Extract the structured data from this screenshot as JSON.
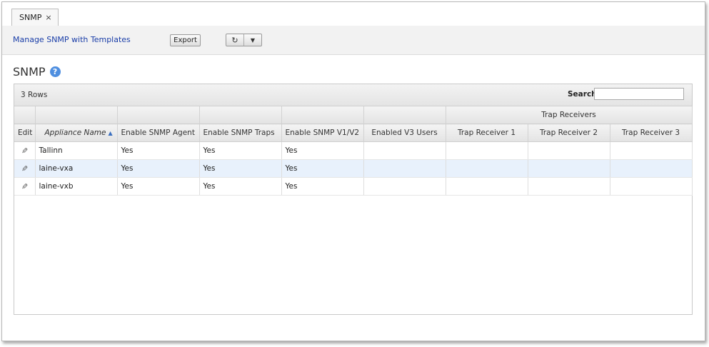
{
  "tab": {
    "label": "SNMP",
    "close": "×"
  },
  "toolbar": {
    "templates_link": "Manage SNMP with Templates",
    "export_label": "Export",
    "refresh_glyph": "↻",
    "menu_glyph": "▼"
  },
  "page": {
    "title": "SNMP",
    "help_glyph": "?"
  },
  "grid": {
    "rows_count": "3 Rows",
    "search_label": "Search",
    "search_value": "",
    "group_header": "Trap Receivers",
    "columns": {
      "edit": "Edit",
      "appliance": "Appliance Name",
      "agent": "Enable SNMP Agent",
      "traps": "Enable SNMP Traps",
      "v1v2": "Enable SNMP V1/V2",
      "v3users": "Enabled V3 Users",
      "tr1": "Trap Receiver 1",
      "tr2": "Trap Receiver 2",
      "tr3": "Trap Receiver 3"
    },
    "sort_glyph": "▲",
    "edit_glyph": "✎",
    "rows": [
      {
        "appliance": "Tallinn",
        "agent": "Yes",
        "traps": "Yes",
        "v1v2": "Yes",
        "v3users": "",
        "tr1": "",
        "tr2": "",
        "tr3": ""
      },
      {
        "appliance": "laine-vxa",
        "agent": "Yes",
        "traps": "Yes",
        "v1v2": "Yes",
        "v3users": "",
        "tr1": "",
        "tr2": "",
        "tr3": ""
      },
      {
        "appliance": "laine-vxb",
        "agent": "Yes",
        "traps": "Yes",
        "v1v2": "Yes",
        "v3users": "",
        "tr1": "",
        "tr2": "",
        "tr3": ""
      }
    ]
  },
  "colors": {
    "link": "#1a3ea8",
    "help": "#4f8fe0",
    "selected_row": "#e8f1fc"
  }
}
